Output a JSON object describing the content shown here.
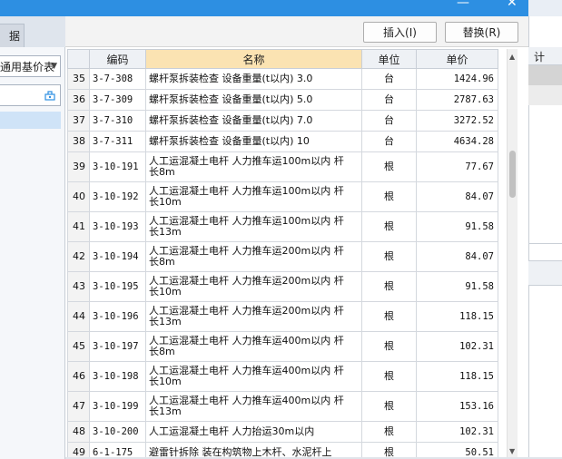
{
  "window": {
    "minimize_glyph": "—",
    "close_glyph": "✕",
    "right_strip_label": "计"
  },
  "left_panel": {
    "tab_label": "据",
    "select_value": "通用基价表",
    "search_placeholder": ""
  },
  "toolbar": {
    "insert_label": "插入(I)",
    "replace_label": "替换(R)"
  },
  "table": {
    "columns": [
      "",
      "编码",
      "名称",
      "单位",
      "单价"
    ],
    "rows": [
      {
        "no": "35",
        "code": "3-7-308",
        "name": "螺杆泵拆装检查 设备重量(t以内) 3.0",
        "name2": "",
        "unit": "台",
        "price": "1424.96"
      },
      {
        "no": "36",
        "code": "3-7-309",
        "name": "螺杆泵拆装检查 设备重量(t以内) 5.0",
        "name2": "",
        "unit": "台",
        "price": "2787.63"
      },
      {
        "no": "37",
        "code": "3-7-310",
        "name": "螺杆泵拆装检查 设备重量(t以内) 7.0",
        "name2": "",
        "unit": "台",
        "price": "3272.52"
      },
      {
        "no": "38",
        "code": "3-7-311",
        "name": "螺杆泵拆装检查 设备重量(t以内) 10",
        "name2": "",
        "unit": "台",
        "price": "4634.28"
      },
      {
        "no": "39",
        "code": "3-10-191",
        "name": "人工运混凝土电杆 人力推车运100m以内 杆",
        "name2": "长8m",
        "unit": "根",
        "price": "77.67"
      },
      {
        "no": "40",
        "code": "3-10-192",
        "name": "人工运混凝土电杆 人力推车运100m以内 杆",
        "name2": "长10m",
        "unit": "根",
        "price": "84.07"
      },
      {
        "no": "41",
        "code": "3-10-193",
        "name": "人工运混凝土电杆 人力推车运100m以内 杆",
        "name2": "长13m",
        "unit": "根",
        "price": "91.58"
      },
      {
        "no": "42",
        "code": "3-10-194",
        "name": "人工运混凝土电杆 人力推车运200m以内 杆",
        "name2": "长8m",
        "unit": "根",
        "price": "84.07"
      },
      {
        "no": "43",
        "code": "3-10-195",
        "name": "人工运混凝土电杆 人力推车运200m以内 杆",
        "name2": "长10m",
        "unit": "根",
        "price": "91.58"
      },
      {
        "no": "44",
        "code": "3-10-196",
        "name": "人工运混凝土电杆 人力推车运200m以内 杆",
        "name2": "长13m",
        "unit": "根",
        "price": "118.15"
      },
      {
        "no": "45",
        "code": "3-10-197",
        "name": "人工运混凝土电杆 人力推车运400m以内 杆",
        "name2": "长8m",
        "unit": "根",
        "price": "102.31"
      },
      {
        "no": "46",
        "code": "3-10-198",
        "name": "人工运混凝土电杆 人力推车运400m以内 杆",
        "name2": "长10m",
        "unit": "根",
        "price": "118.15"
      },
      {
        "no": "47",
        "code": "3-10-199",
        "name": "人工运混凝土电杆 人力推车运400m以内 杆",
        "name2": "长13m",
        "unit": "根",
        "price": "153.16"
      },
      {
        "no": "48",
        "code": "3-10-200",
        "name": "人工运混凝土电杆 人力抬运30m以内",
        "name2": "",
        "unit": "根",
        "price": "102.31"
      },
      {
        "no": "49",
        "code": "6-1-175",
        "name": "避雷针拆除 装在构筑物上木杆、水泥杆上",
        "name2": "",
        "unit": "根",
        "price": "50.51"
      }
    ]
  },
  "colors": {
    "title_bar": "#2d8fe2",
    "header_highlight": "#fbe3b2",
    "selected_row": "#cfe3f7"
  }
}
